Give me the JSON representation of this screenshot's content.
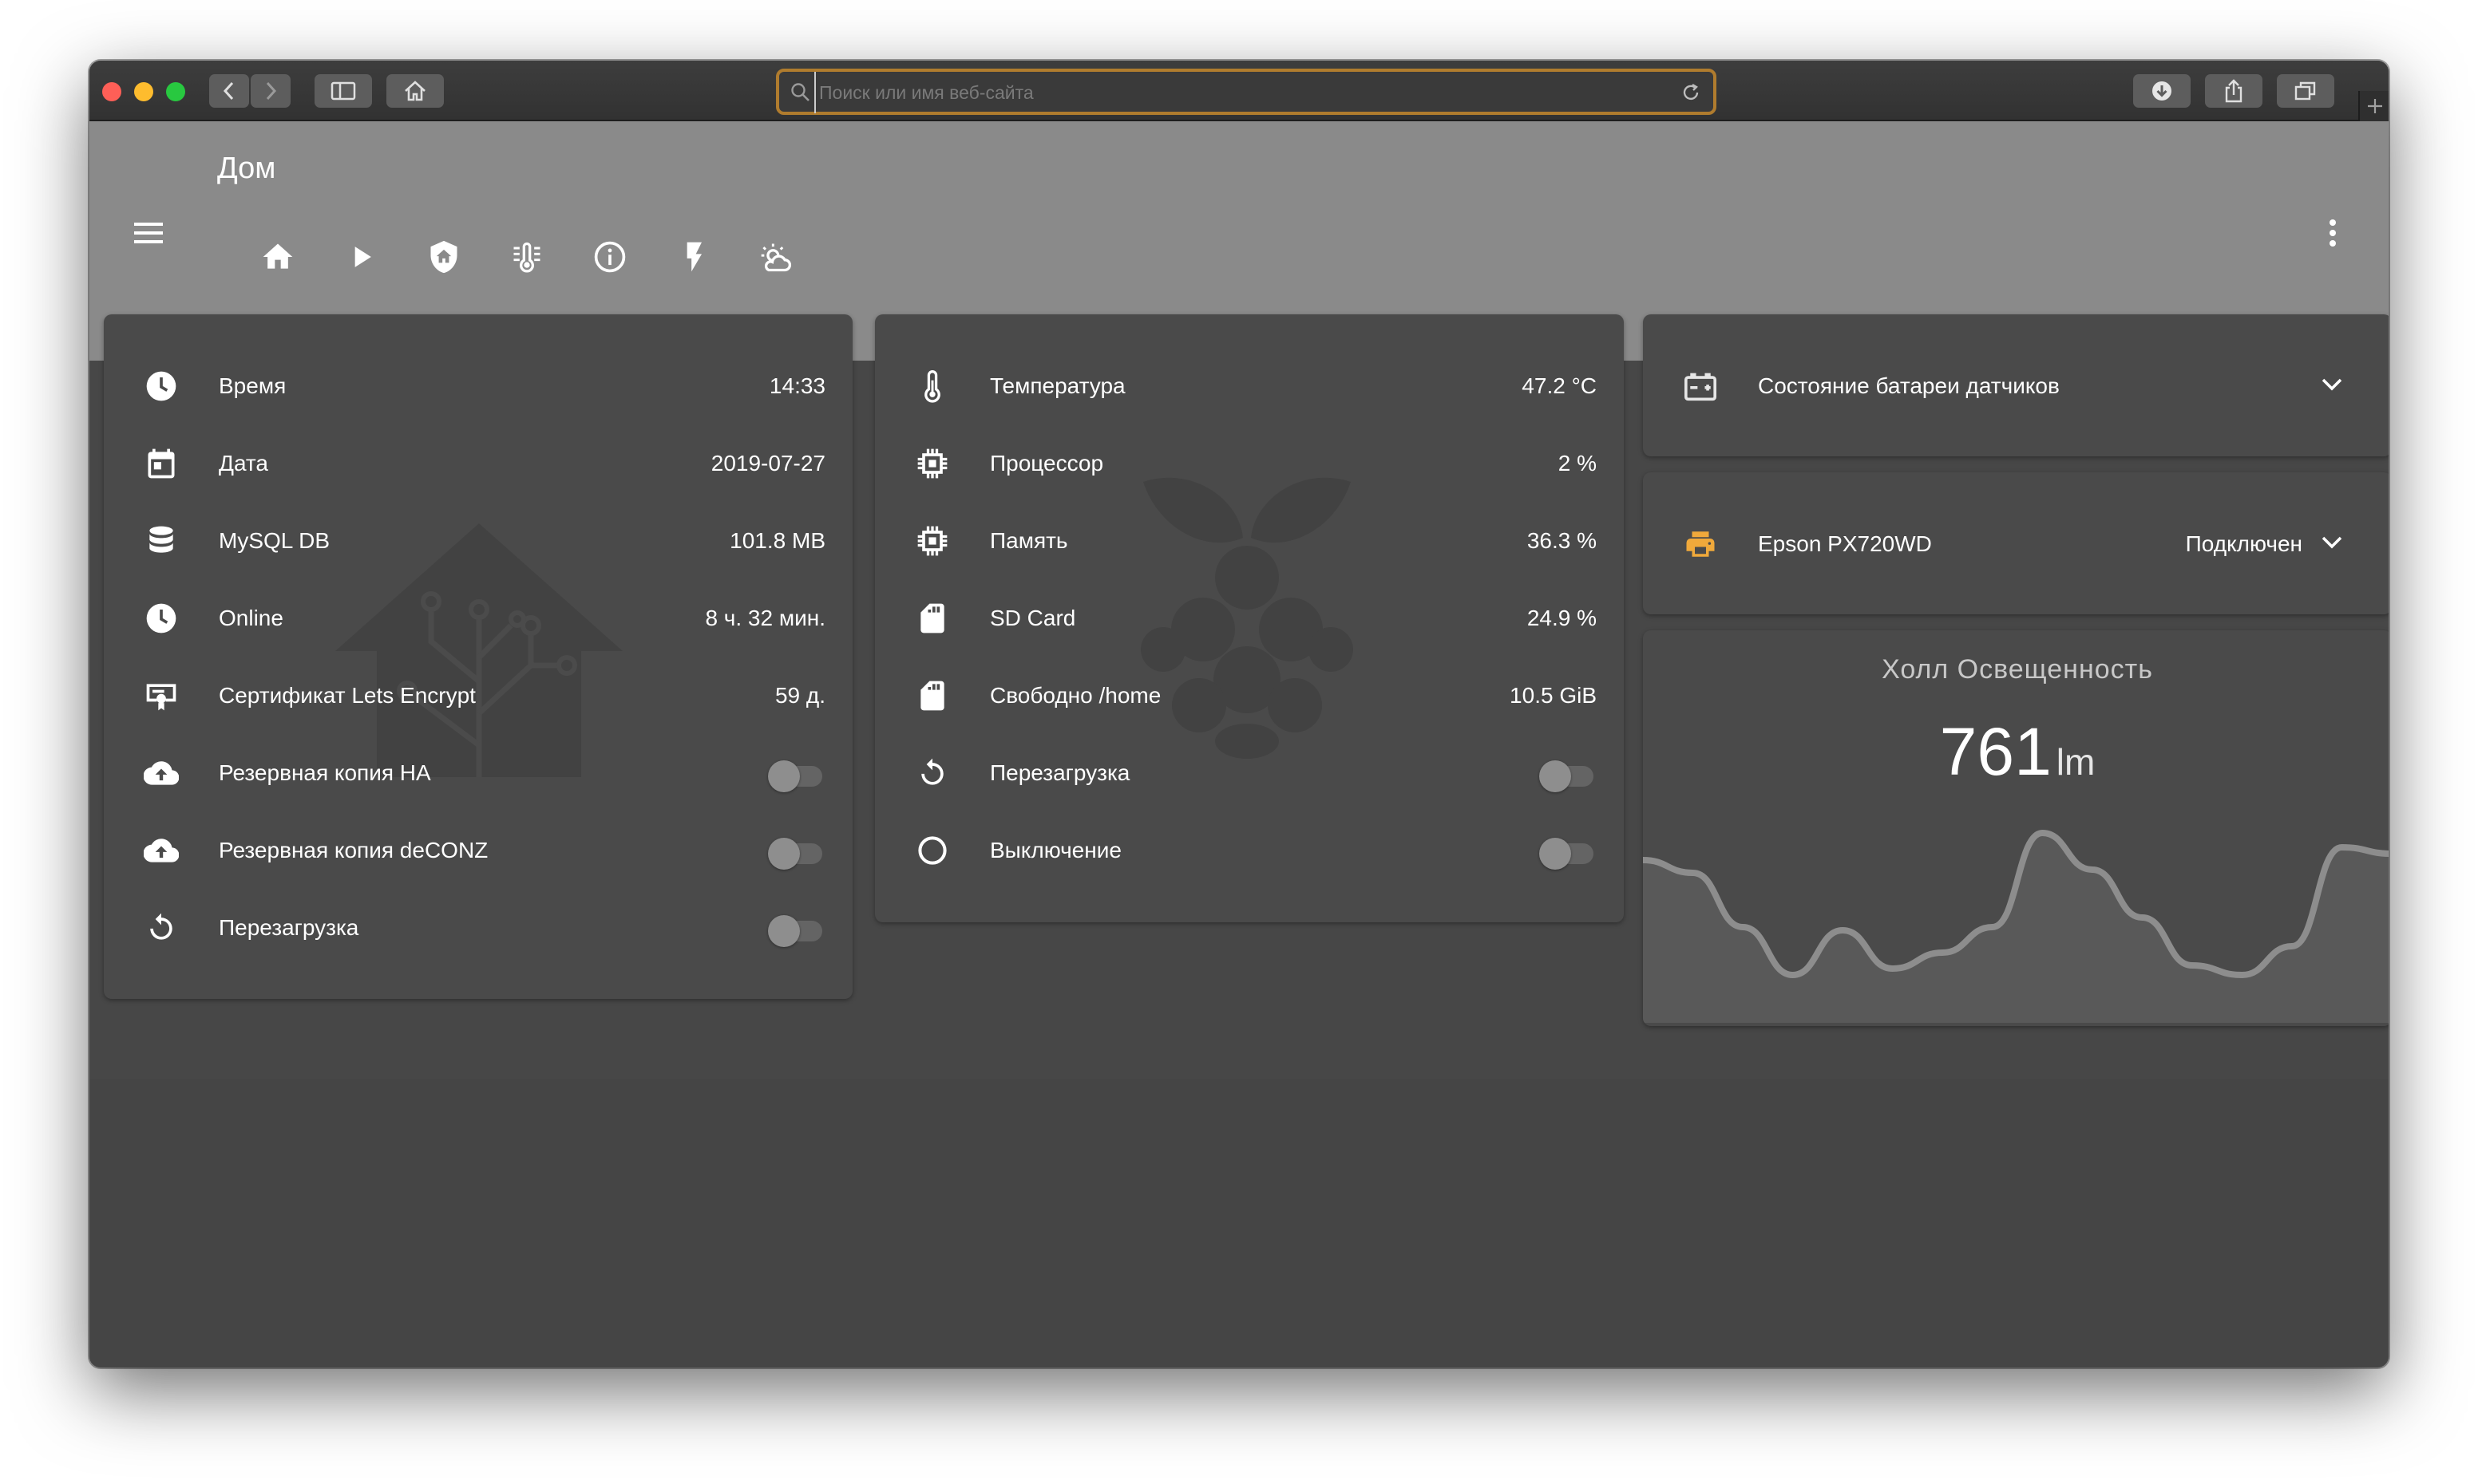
{
  "browser": {
    "address_placeholder": "Поиск или имя веб-сайта",
    "address_value": ""
  },
  "header": {
    "title": "Дом",
    "tabs": [
      {
        "icon": "home-icon"
      },
      {
        "icon": "play-icon"
      },
      {
        "icon": "shield-home-icon"
      },
      {
        "icon": "thermometer-lines-icon"
      },
      {
        "icon": "information-icon",
        "active": true
      },
      {
        "icon": "flash-icon"
      },
      {
        "icon": "weather-partly-cloudy-icon"
      }
    ]
  },
  "system_card": {
    "rows": [
      {
        "icon": "clock-icon",
        "label": "Время",
        "value": "14:33"
      },
      {
        "icon": "calendar-icon",
        "label": "Дата",
        "value": "2019-07-27"
      },
      {
        "icon": "database-icon",
        "label": "MySQL DB",
        "value": "101.8 MB"
      },
      {
        "icon": "clock-icon",
        "label": "Online",
        "value": "8 ч. 32 мин."
      },
      {
        "icon": "certificate-icon",
        "label": "Сертификат Lets Encrypt",
        "value": "59 д."
      },
      {
        "icon": "cloud-upload-icon",
        "label": "Резервная копия HA",
        "toggle": false
      },
      {
        "icon": "cloud-upload-icon",
        "label": "Резервная копия deCONZ",
        "toggle": false
      },
      {
        "icon": "restart-icon",
        "label": "Перезагрузка",
        "toggle": false
      }
    ]
  },
  "pi_card": {
    "rows": [
      {
        "icon": "thermometer-icon",
        "label": "Температура",
        "value": "47.2 °C"
      },
      {
        "icon": "chip-icon",
        "label": "Процессор",
        "value": "2 %"
      },
      {
        "icon": "chip-icon",
        "label": "Память",
        "value": "36.3 %"
      },
      {
        "icon": "sd-card-icon",
        "label": "SD Card",
        "value": "24.9 %"
      },
      {
        "icon": "sd-card-icon",
        "label": "Свободно /home",
        "value": "10.5 GiB"
      },
      {
        "icon": "restart-icon",
        "label": "Перезагрузка",
        "toggle": false
      },
      {
        "icon": "power-circle-icon",
        "label": "Выключение",
        "toggle": false
      }
    ]
  },
  "battery_card": {
    "icon": "battery-charging-icon",
    "label": "Состояние батареи датчиков"
  },
  "printer_card": {
    "icon": "printer-icon",
    "label": "Epson PX720WD",
    "status": "Подключен",
    "icon_color": "#f0a93b"
  },
  "sensor_card": {
    "title": "Холл Освещенность",
    "value": "761",
    "unit": "lm",
    "history": [
      0.78,
      0.7,
      0.36,
      0.06,
      0.34,
      0.1,
      0.2,
      0.36,
      0.95,
      0.72,
      0.42,
      0.12,
      0.06,
      0.24,
      0.86,
      0.82
    ]
  },
  "colors": {
    "accent": "#b07c2e",
    "header_bg": "#8a8a8a",
    "page_bg": "#474747",
    "card_bg": "#4a4a4a"
  }
}
